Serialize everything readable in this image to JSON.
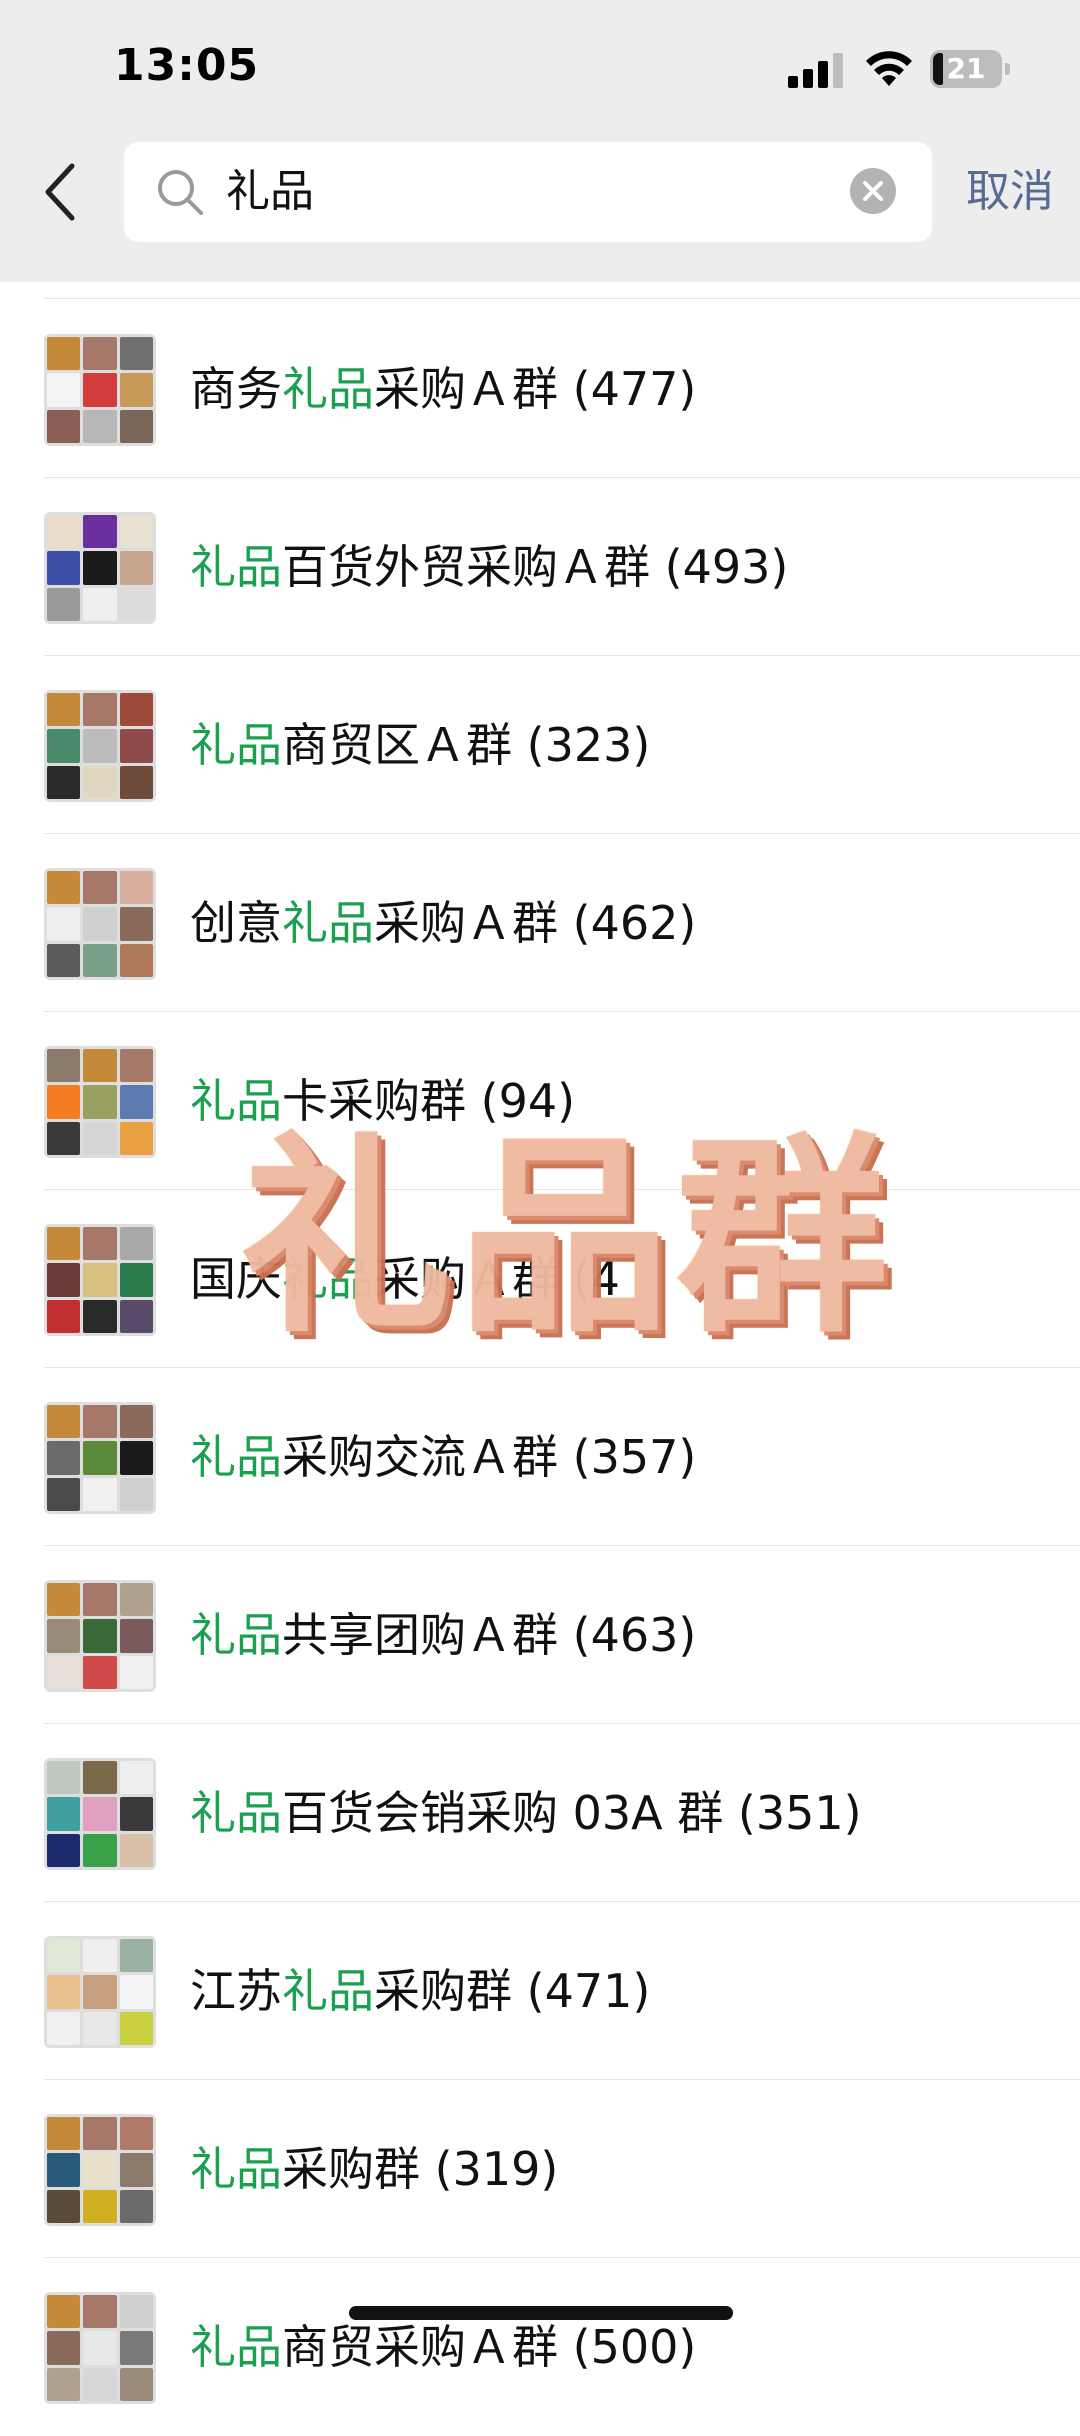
{
  "status_bar": {
    "time": "13:05",
    "battery": "21"
  },
  "search": {
    "query": "礼品",
    "cancel_label": "取消"
  },
  "colors": {
    "highlight": "#1aa04e",
    "cancel": "#576b95",
    "watermark": "#efb99f"
  },
  "results": [
    {
      "pre": "商务",
      "hl": "礼品",
      "post": "采购Ａ群 (477)"
    },
    {
      "pre": "",
      "hl": "礼品",
      "post": "百货外贸采购Ａ群 (493)"
    },
    {
      "pre": "",
      "hl": "礼品",
      "post": "商贸区Ａ群 (323)"
    },
    {
      "pre": "创意",
      "hl": "礼品",
      "post": "采购Ａ群 (462)"
    },
    {
      "pre": "",
      "hl": "礼品",
      "post": "卡采购群 (94)"
    },
    {
      "pre": "国庆",
      "hl": "礼品",
      "post": "采购Ａ群 (4"
    },
    {
      "pre": "",
      "hl": "礼品",
      "post": "采购交流Ａ群 (357)"
    },
    {
      "pre": "",
      "hl": "礼品",
      "post": "共享团购Ａ群 (463)"
    },
    {
      "pre": "",
      "hl": "礼品",
      "post": "百货会销采购 03A 群 (351)"
    },
    {
      "pre": "江苏",
      "hl": "礼品",
      "post": "采购群 (471)"
    },
    {
      "pre": "",
      "hl": "礼品",
      "post": "采购群 (319)"
    },
    {
      "pre": "",
      "hl": "礼品",
      "post": "商贸采购Ａ群 (500)"
    }
  ],
  "watermark": "礼品群"
}
